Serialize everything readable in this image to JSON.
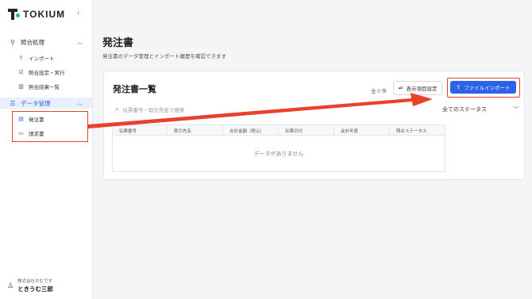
{
  "app": {
    "logo": "TOKIUM",
    "collapse_icon": "chevron-left-icon"
  },
  "sidebar": {
    "groups": [
      {
        "label": "照合処理",
        "icon": "reconcile-icon",
        "expanded": true,
        "items": [
          {
            "label": "インポート",
            "icon": "upload-icon"
          },
          {
            "label": "照合設定・実行",
            "icon": "checkbox-icon"
          },
          {
            "label": "照合結果一覧",
            "icon": "bar-chart-icon"
          }
        ]
      },
      {
        "label": "データ管理",
        "icon": "database-icon",
        "expanded": true,
        "active": true,
        "items": [
          {
            "label": "発注書",
            "icon": "document-icon",
            "current": true
          },
          {
            "label": "請求書",
            "icon": "card-icon"
          }
        ]
      }
    ],
    "user": {
      "company": "株式会社おむです",
      "name": "ときうむ三郎"
    }
  },
  "page": {
    "title": "発注書",
    "subtitle": "発注書のデータ管理とインポート履歴を確認できます"
  },
  "card": {
    "title": "発注書一覧",
    "count": "全 0 件",
    "display_settings_label": "表示項目設定",
    "import_label": "ファイルインポート",
    "search_placeholder": "伝票番号・取引先名で検索",
    "status_filter": "全てのステータス",
    "columns": [
      "伝票番号",
      "取引先名",
      "合計金額（税込）",
      "伝票日付",
      "会計年度",
      "照合ステータス"
    ],
    "empty_message": "データがありません"
  },
  "colors": {
    "accent": "#2b63e8",
    "highlight": "#e8412c",
    "active_bg": "#e8f0fd",
    "brand_dot": "#1fb58f"
  }
}
